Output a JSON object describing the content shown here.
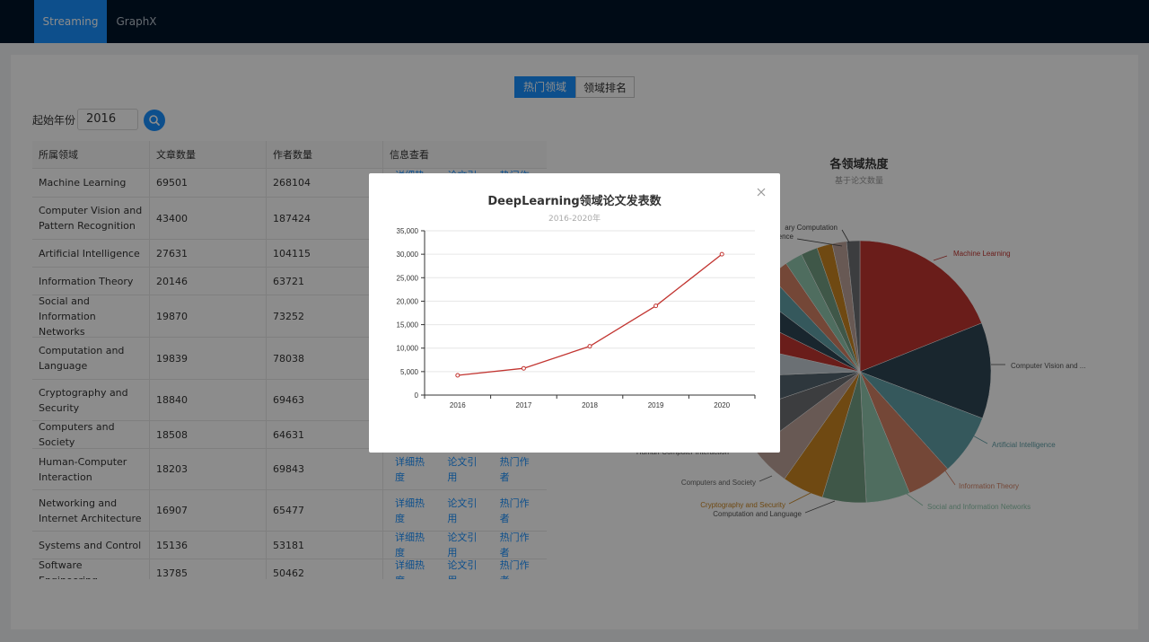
{
  "nav": {
    "items": [
      {
        "label": "Streaming",
        "active": true
      },
      {
        "label": "GraphX",
        "active": false
      }
    ]
  },
  "tabs": {
    "hot": "热门领域",
    "rank": "领域排名"
  },
  "filter": {
    "label": "起始年份",
    "year": "2016"
  },
  "table": {
    "headers": [
      "所属领域",
      "文章数量",
      "作者数量",
      "信息查看"
    ],
    "action_labels": [
      "详细热度",
      "论文引用",
      "热门作者"
    ],
    "rows": [
      {
        "field": "Machine Learning",
        "articles": "69501",
        "authors": "268104"
      },
      {
        "field": "Computer Vision and Pattern Recognition",
        "articles": "43400",
        "authors": "187424"
      },
      {
        "field": "Artificial Intelligence",
        "articles": "27631",
        "authors": "104115"
      },
      {
        "field": "Information Theory",
        "articles": "20146",
        "authors": "63721"
      },
      {
        "field": "Social and Information Networks",
        "articles": "19870",
        "authors": "73252"
      },
      {
        "field": "Computation and Language",
        "articles": "19839",
        "authors": "78038"
      },
      {
        "field": "Cryptography and Security",
        "articles": "18840",
        "authors": "69463"
      },
      {
        "field": "Computers and Society",
        "articles": "18508",
        "authors": "64631"
      },
      {
        "field": "Human-Computer Interaction",
        "articles": "18203",
        "authors": "69843"
      },
      {
        "field": "Networking and Internet Architecture",
        "articles": "16907",
        "authors": "65477"
      },
      {
        "field": "Systems and Control",
        "articles": "15136",
        "authors": "53181"
      },
      {
        "field": "Software Engineering",
        "articles": "13785",
        "authors": "50462"
      }
    ]
  },
  "pie": {
    "title": "各领域热度",
    "subtitle": "基于论文数量",
    "labels": [
      "Machine Learning",
      "Computer Vision and ...",
      "Artificial Intelligence",
      "Information Theory",
      "Social and Information Networks",
      "Computation and Language",
      "Cryptography and Security",
      "Computers and Society",
      "Human-Computer Interaction",
      "ary Computation",
      "ence"
    ],
    "colors": [
      "#c23531",
      "#2f4554",
      "#61a0a8",
      "#d48265",
      "#91c7ae",
      "#749f83",
      "#ca8622",
      "#bda29a",
      "#6e7074",
      "#546570",
      "#c4ccd3"
    ],
    "slices": [
      69501,
      43400,
      27631,
      20146,
      19870,
      19839,
      18840,
      18508,
      18203,
      16907,
      15136,
      13785,
      11000,
      10000,
      9000,
      8000,
      7500,
      7000,
      6500,
      6000
    ]
  },
  "modal": {
    "title": "DeepLearning领域论文发表数",
    "subtitle": "2016-2020年",
    "close_icon": "close-icon",
    "chart_data": {
      "type": "line",
      "x": [
        "2016",
        "2017",
        "2018",
        "2019",
        "2020"
      ],
      "y": [
        4200,
        5700,
        10400,
        19000,
        30000
      ],
      "ylim": [
        0,
        35000
      ],
      "yticks": [
        "0",
        "5,000",
        "10,000",
        "15,000",
        "20,000",
        "25,000",
        "30,000",
        "35,000"
      ],
      "color": "#c23531",
      "grid": true
    }
  }
}
